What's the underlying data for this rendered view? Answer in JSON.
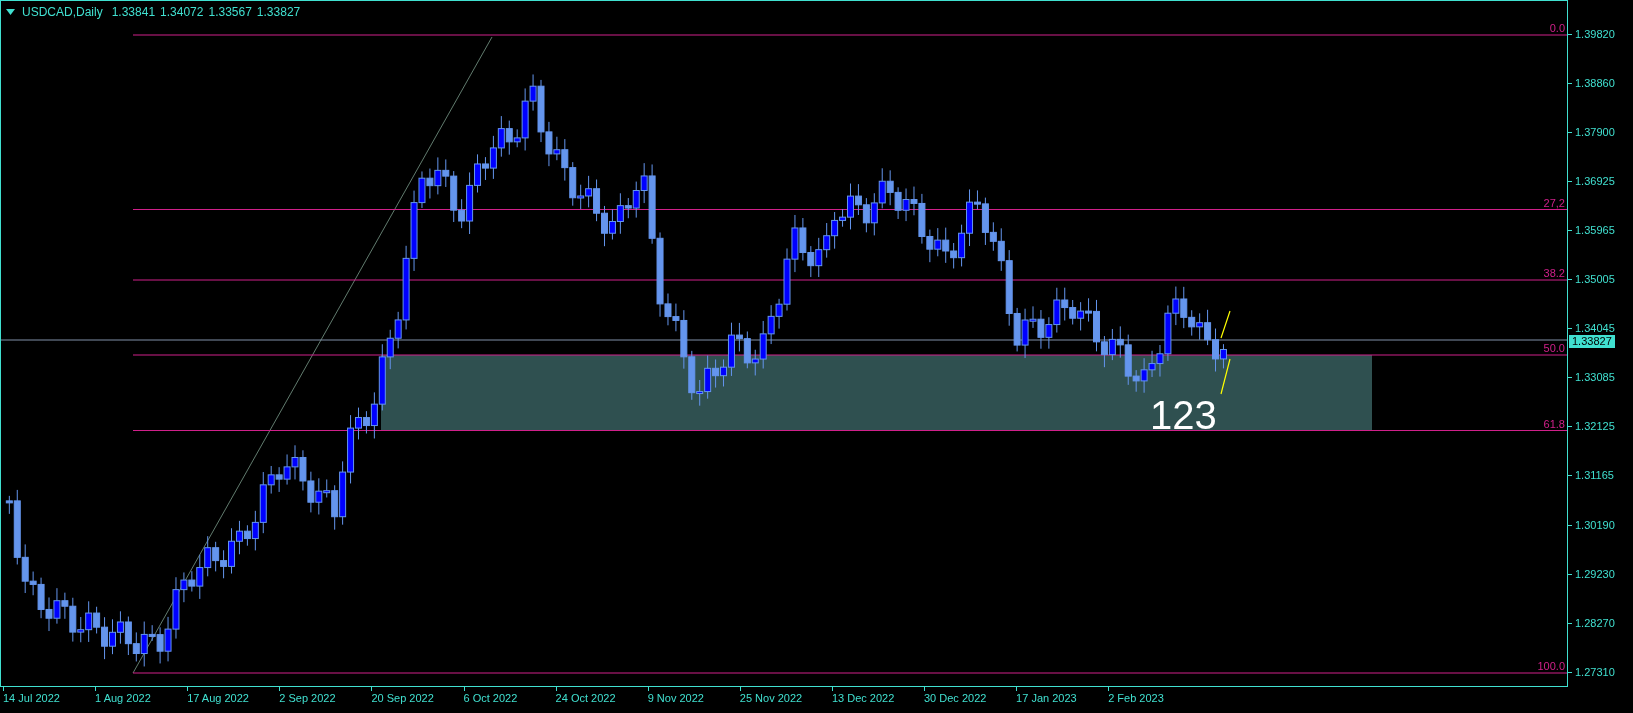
{
  "header": {
    "symbol": "USDCAD,Daily",
    "quotes": [
      "1.33841",
      "1.34072",
      "1.33567",
      "1.33827"
    ]
  },
  "price_axis": [
    "1.39820",
    "1.38860",
    "1.37900",
    "1.36925",
    "1.35965",
    "1.35005",
    "1.34045",
    "1.33085",
    "1.32125",
    "1.31165",
    "1.30190",
    "1.29230",
    "1.28270",
    "1.27310"
  ],
  "current_price": "1.33827",
  "fib_levels": [
    "0.0",
    "27,2",
    "38.2",
    "50.0",
    "61.8",
    "100.0"
  ],
  "zone_label": "123",
  "date_axis": [
    "14 Jul 2022",
    "1 Aug 2022",
    "17 Aug 2022",
    "2 Sep 2022",
    "20 Sep 2022",
    "6 Oct 2022",
    "24 Oct 2022",
    "9 Nov 2022",
    "25 Nov 2022",
    "13 Dec 2022",
    "30 Dec 2022",
    "17 Jan 2023",
    "2 Feb 2023"
  ]
}
